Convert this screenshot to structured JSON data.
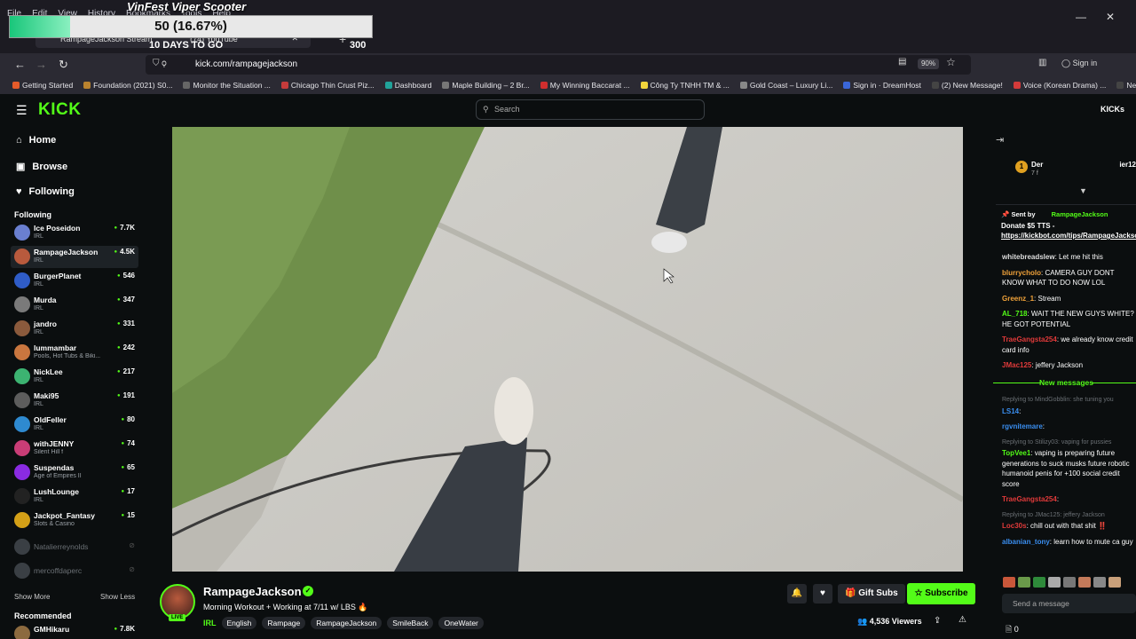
{
  "browser": {
    "menu": [
      "File",
      "Edit",
      "View",
      "History",
      "Bookmarks",
      "Tools",
      "Help"
    ],
    "tab_label": "RampageJackson Stream",
    "tab2_label": "(74) YouTube",
    "url": "kick.com/rampagejackson",
    "zoom": "90%",
    "signin": "Sign in",
    "bookmarks": [
      {
        "label": "Getting Started",
        "color": "#e55b2a"
      },
      {
        "label": "Foundation (2021) S0...",
        "color": "#b9822e"
      },
      {
        "label": "Monitor the Situation ...",
        "color": "#666666"
      },
      {
        "label": "Chicago Thin Crust Piz...",
        "color": "#c43b3b"
      },
      {
        "label": "Dashboard",
        "color": "#21a39a"
      },
      {
        "label": "Maple Building – 2 Br...",
        "color": "#777777"
      },
      {
        "label": "My Winning Baccarat ...",
        "color": "#d02e2e"
      },
      {
        "label": "Công Ty TNHH TM & ...",
        "color": "#f2d53c"
      },
      {
        "label": "Gold Coast – Luxury Li...",
        "color": "#888888"
      },
      {
        "label": "Sign in · DreamHost",
        "color": "#3a66d8"
      },
      {
        "label": "(2) New Message!",
        "color": "#444444"
      },
      {
        "label": "Voice (Korean Drama) ...",
        "color": "#d33a3a"
      },
      {
        "label": "New Messa",
        "color": "#444444"
      }
    ]
  },
  "overlay": {
    "title": "VinFest Viper Scooter",
    "progress_label": "50 (16.67%)",
    "progress_fraction": 0.1667,
    "days": "10 DAYS TO GO",
    "goal": "300"
  },
  "kick": {
    "logo": "KICK",
    "search_placeholder": "Search",
    "kicks_label": "KICKs",
    "nav": [
      {
        "label": "Home",
        "icon": "home-icon",
        "glyph": "⌂"
      },
      {
        "label": "Browse",
        "icon": "browse-icon",
        "glyph": "▣"
      },
      {
        "label": "Following",
        "icon": "heart-icon",
        "glyph": "♥"
      }
    ],
    "following_title": "Following",
    "channels": [
      {
        "name": "Ice Poseidon",
        "category": "IRL",
        "viewers": "7.7K",
        "color": "#6a7fd0"
      },
      {
        "name": "RampageJackson",
        "category": "IRL",
        "viewers": "4.5K",
        "color": "#b85a3d"
      },
      {
        "name": "BurgerPlanet",
        "category": "IRL",
        "viewers": "546",
        "color": "#2f5cc7"
      },
      {
        "name": "Murda",
        "category": "IRL",
        "viewers": "347",
        "color": "#7a7a7a"
      },
      {
        "name": "jandro",
        "category": "IRL",
        "viewers": "331",
        "color": "#8b5a3c"
      },
      {
        "name": "lummambar",
        "category": "Pools, Hot Tubs & Biki...",
        "viewers": "242",
        "color": "#c9763f"
      },
      {
        "name": "NickLee",
        "category": "IRL",
        "viewers": "217",
        "color": "#3cb371"
      },
      {
        "name": "Maki95",
        "category": "IRL",
        "viewers": "191",
        "color": "#5d5d5d"
      },
      {
        "name": "OldFeller",
        "category": "IRL",
        "viewers": "80",
        "color": "#2e8ad0"
      },
      {
        "name": "withJENNY",
        "category": "Silent Hill f",
        "viewers": "74",
        "color": "#c93d76"
      },
      {
        "name": "Suspendas",
        "category": "Age of Empires II",
        "viewers": "65",
        "color": "#8a2be2"
      },
      {
        "name": "LushLounge",
        "category": "IRL",
        "viewers": "17",
        "color": "#222222"
      },
      {
        "name": "Jackpot_Fantasy",
        "category": "Slots & Casino",
        "viewers": "15",
        "color": "#d4a017"
      }
    ],
    "offline_channels": [
      "Natalierreynolds",
      "mercoffdaperc"
    ],
    "show_more": "Show More",
    "show_less": "Show Less",
    "recommended_title": "Recommended",
    "recommended": [
      {
        "name": "GMHikaru",
        "viewers": "7.8K",
        "color": "#8c6a3f"
      }
    ]
  },
  "stream": {
    "streamer": "RampageJackson",
    "live": "LIVE",
    "title": "Morning Workout + Working at 7/11 w/ LBS 🔥",
    "category": "IRL",
    "tags": [
      "English",
      "Rampage",
      "RampageJackson",
      "SmileBack",
      "OneWater"
    ],
    "gift_subs": "Gift Subs",
    "subscribe": "Subscribe",
    "viewers": "4,536 Viewers"
  },
  "chat": {
    "pinned_user_name": "Der",
    "pinned_user_sub": "7 f",
    "pinned_user_right": "ier12",
    "pinned_sent_by": "Sent by",
    "pinned_user": "RampageJackson",
    "pinned_text": "Donate $5 TTS - ",
    "pinned_link": "https://kickbot.com/tips/RampageJackson",
    "messages": [
      {
        "user": "whitebreadslew",
        "color": "#dddddd",
        "text": "Let me hit this"
      },
      {
        "user": "blurrycholo",
        "color": "#f0a23a",
        "text": "CAMERA GUY DONT KNOW WHAT TO DO NOW LOL"
      },
      {
        "user": "Greenz_1",
        "color": "#f0a23a",
        "text": "Stream"
      },
      {
        "user": "AL_718",
        "color": "#53fc18",
        "text": "WAIT THE NEW GUYS WHITE? HE GOT POTENTIAL"
      },
      {
        "user": "TraeGangsta254",
        "color": "#e03a3a",
        "text": "we already know credit card info"
      },
      {
        "user": "JMac125",
        "color": "#e03a3a",
        "text": "jeffery Jackson"
      }
    ],
    "new_messages": "New messages",
    "messages2": [
      {
        "reply": "Replying to MindGobblin: she tuning you",
        "user": "LS14",
        "color": "#3a8ef0",
        "text": ""
      },
      {
        "reply": "",
        "user": "rgvnitemare",
        "color": "#3a8ef0",
        "text": ""
      },
      {
        "reply": "Replying to Stilizy03: vaping for pussies",
        "user": "TopVee1",
        "color": "#53fc18",
        "text": "vaping is preparing future generations to suck musks future robotic humanoid penis for +100 social credit score"
      },
      {
        "reply": "",
        "user": "TraeGangsta254",
        "color": "#e03a3a",
        "text": ""
      },
      {
        "reply": "Replying to JMac125: jeffery Jackson",
        "user": "Loc30s",
        "color": "#e03a3a",
        "text": "chill out with that shit ‼️"
      },
      {
        "reply": "",
        "user": "albanian_tony",
        "color": "#3a8ef0",
        "text": "learn how to mute ca guy"
      }
    ],
    "send_placeholder": "Send a message",
    "footer_count": "0"
  }
}
